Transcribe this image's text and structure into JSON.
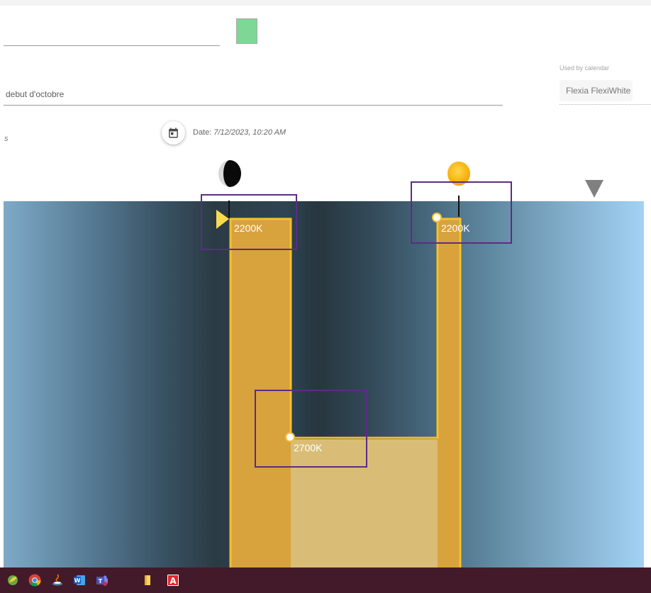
{
  "form": {
    "description": "debut d'octobre",
    "color": "#7fd796",
    "calendar_label": "Used by calendar",
    "calendar_value": "Flexia FlexiWhite",
    "small_text": "s",
    "date_label": "Date:",
    "date_value": "7/12/2023, 10:20 AM"
  },
  "timeline": {
    "events": [
      {
        "label": "2200K"
      },
      {
        "label": "2200K"
      },
      {
        "label": "2700K"
      }
    ]
  },
  "icons": {
    "calendar": "calendar-icon",
    "moon": "half-moon-icon",
    "sun": "sun-icon",
    "now": "down-triangle-icon"
  },
  "colors": {
    "accent": "#f6c02a",
    "highlight": "#5c2c86",
    "taskbar": "#431a2a"
  },
  "taskbar": {
    "apps": [
      "green-leaf-app-icon",
      "chrome-icon",
      "java-icon",
      "word-icon",
      "teams-icon",
      "file-explorer-icon",
      "acrobat-icon"
    ]
  }
}
